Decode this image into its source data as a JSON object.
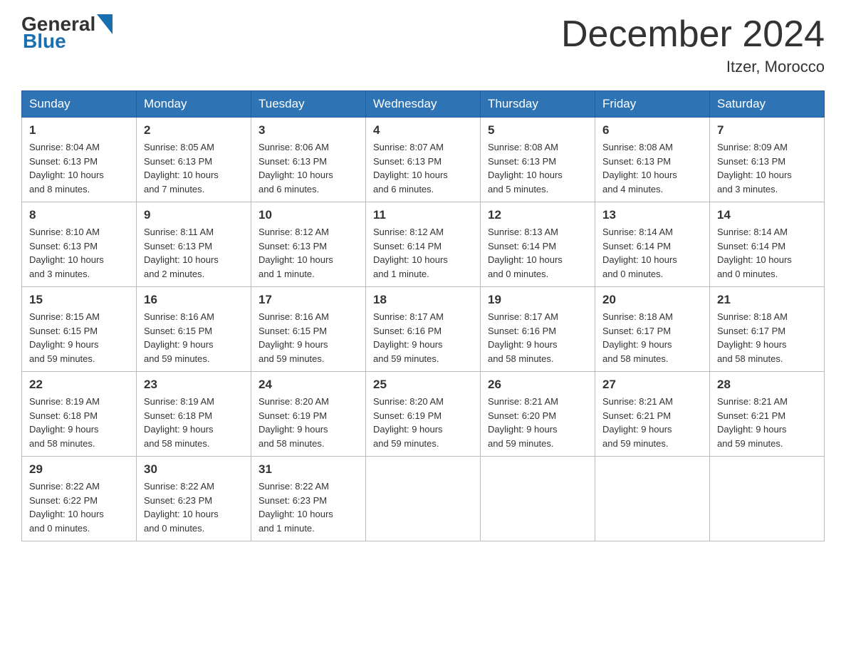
{
  "logo": {
    "general": "General",
    "blue": "Blue"
  },
  "header": {
    "title": "December 2024",
    "subtitle": "Itzer, Morocco"
  },
  "days_of_week": [
    "Sunday",
    "Monday",
    "Tuesday",
    "Wednesday",
    "Thursday",
    "Friday",
    "Saturday"
  ],
  "weeks": [
    [
      {
        "day": "1",
        "sunrise": "8:04 AM",
        "sunset": "6:13 PM",
        "daylight": "10 hours and 8 minutes."
      },
      {
        "day": "2",
        "sunrise": "8:05 AM",
        "sunset": "6:13 PM",
        "daylight": "10 hours and 7 minutes."
      },
      {
        "day": "3",
        "sunrise": "8:06 AM",
        "sunset": "6:13 PM",
        "daylight": "10 hours and 6 minutes."
      },
      {
        "day": "4",
        "sunrise": "8:07 AM",
        "sunset": "6:13 PM",
        "daylight": "10 hours and 6 minutes."
      },
      {
        "day": "5",
        "sunrise": "8:08 AM",
        "sunset": "6:13 PM",
        "daylight": "10 hours and 5 minutes."
      },
      {
        "day": "6",
        "sunrise": "8:08 AM",
        "sunset": "6:13 PM",
        "daylight": "10 hours and 4 minutes."
      },
      {
        "day": "7",
        "sunrise": "8:09 AM",
        "sunset": "6:13 PM",
        "daylight": "10 hours and 3 minutes."
      }
    ],
    [
      {
        "day": "8",
        "sunrise": "8:10 AM",
        "sunset": "6:13 PM",
        "daylight": "10 hours and 3 minutes."
      },
      {
        "day": "9",
        "sunrise": "8:11 AM",
        "sunset": "6:13 PM",
        "daylight": "10 hours and 2 minutes."
      },
      {
        "day": "10",
        "sunrise": "8:12 AM",
        "sunset": "6:13 PM",
        "daylight": "10 hours and 1 minute."
      },
      {
        "day": "11",
        "sunrise": "8:12 AM",
        "sunset": "6:14 PM",
        "daylight": "10 hours and 1 minute."
      },
      {
        "day": "12",
        "sunrise": "8:13 AM",
        "sunset": "6:14 PM",
        "daylight": "10 hours and 0 minutes."
      },
      {
        "day": "13",
        "sunrise": "8:14 AM",
        "sunset": "6:14 PM",
        "daylight": "10 hours and 0 minutes."
      },
      {
        "day": "14",
        "sunrise": "8:14 AM",
        "sunset": "6:14 PM",
        "daylight": "10 hours and 0 minutes."
      }
    ],
    [
      {
        "day": "15",
        "sunrise": "8:15 AM",
        "sunset": "6:15 PM",
        "daylight": "9 hours and 59 minutes."
      },
      {
        "day": "16",
        "sunrise": "8:16 AM",
        "sunset": "6:15 PM",
        "daylight": "9 hours and 59 minutes."
      },
      {
        "day": "17",
        "sunrise": "8:16 AM",
        "sunset": "6:15 PM",
        "daylight": "9 hours and 59 minutes."
      },
      {
        "day": "18",
        "sunrise": "8:17 AM",
        "sunset": "6:16 PM",
        "daylight": "9 hours and 59 minutes."
      },
      {
        "day": "19",
        "sunrise": "8:17 AM",
        "sunset": "6:16 PM",
        "daylight": "9 hours and 58 minutes."
      },
      {
        "day": "20",
        "sunrise": "8:18 AM",
        "sunset": "6:17 PM",
        "daylight": "9 hours and 58 minutes."
      },
      {
        "day": "21",
        "sunrise": "8:18 AM",
        "sunset": "6:17 PM",
        "daylight": "9 hours and 58 minutes."
      }
    ],
    [
      {
        "day": "22",
        "sunrise": "8:19 AM",
        "sunset": "6:18 PM",
        "daylight": "9 hours and 58 minutes."
      },
      {
        "day": "23",
        "sunrise": "8:19 AM",
        "sunset": "6:18 PM",
        "daylight": "9 hours and 58 minutes."
      },
      {
        "day": "24",
        "sunrise": "8:20 AM",
        "sunset": "6:19 PM",
        "daylight": "9 hours and 58 minutes."
      },
      {
        "day": "25",
        "sunrise": "8:20 AM",
        "sunset": "6:19 PM",
        "daylight": "9 hours and 59 minutes."
      },
      {
        "day": "26",
        "sunrise": "8:21 AM",
        "sunset": "6:20 PM",
        "daylight": "9 hours and 59 minutes."
      },
      {
        "day": "27",
        "sunrise": "8:21 AM",
        "sunset": "6:21 PM",
        "daylight": "9 hours and 59 minutes."
      },
      {
        "day": "28",
        "sunrise": "8:21 AM",
        "sunset": "6:21 PM",
        "daylight": "9 hours and 59 minutes."
      }
    ],
    [
      {
        "day": "29",
        "sunrise": "8:22 AM",
        "sunset": "6:22 PM",
        "daylight": "10 hours and 0 minutes."
      },
      {
        "day": "30",
        "sunrise": "8:22 AM",
        "sunset": "6:23 PM",
        "daylight": "10 hours and 0 minutes."
      },
      {
        "day": "31",
        "sunrise": "8:22 AM",
        "sunset": "6:23 PM",
        "daylight": "10 hours and 1 minute."
      },
      null,
      null,
      null,
      null
    ]
  ],
  "labels": {
    "sunrise": "Sunrise:",
    "sunset": "Sunset:",
    "daylight": "Daylight:"
  }
}
